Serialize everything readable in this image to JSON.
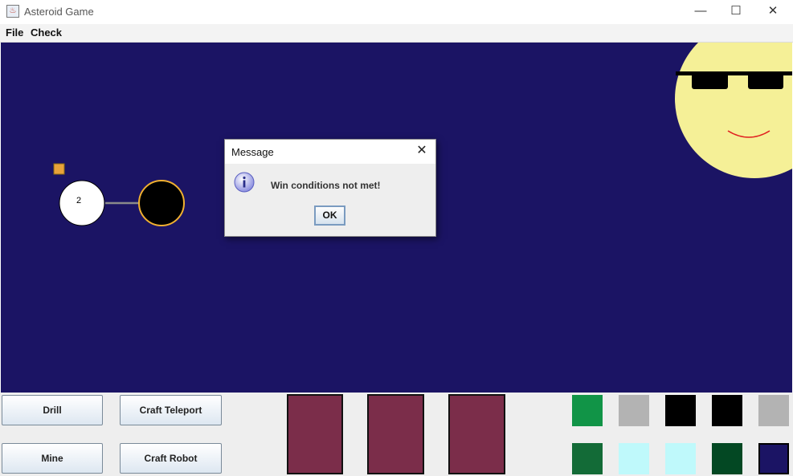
{
  "window": {
    "title": "Asteroid Game",
    "minimize_glyph": "—",
    "maximize_glyph": "☐",
    "close_glyph": "✕",
    "app_icon_glyph": "♨"
  },
  "menu": [
    {
      "label": "File"
    },
    {
      "label": "Check"
    }
  ],
  "game": {
    "background_color": "#1b1464",
    "asteroids": [
      {
        "label": "2",
        "fill": "#ffffff",
        "outline": "#000000"
      },
      {
        "label": "",
        "fill": "#000000",
        "outline": "#f0b030"
      }
    ],
    "sun": {
      "fill": "#f5f097",
      "glasses": "#000000",
      "smile": "#e02020"
    },
    "settler_color": "#e8a33a"
  },
  "dialog": {
    "title": "Message",
    "message": "Win conditions not met!",
    "ok_label": "OK",
    "icon": "info-icon",
    "close_glyph": "✕"
  },
  "buttons": {
    "drill": "Drill",
    "craft_teleport": "Craft Teleport",
    "mine": "Mine",
    "craft_robot": "Craft Robot"
  },
  "inventory_slots": [
    {
      "color": "#7b2d4a"
    },
    {
      "color": "#7b2d4a"
    },
    {
      "color": "#7b2d4a"
    }
  ],
  "resource_colors": [
    {
      "color": "#119447"
    },
    {
      "color": "#b3b3b3"
    },
    {
      "color": "#000000"
    },
    {
      "color": "#000000"
    },
    {
      "color": "#b3b3b3"
    },
    {
      "color": "#136b37"
    },
    {
      "color": "#bff9fb"
    },
    {
      "color": "#bff9fb"
    },
    {
      "color": "#034823"
    },
    {
      "color": "#1b1464"
    }
  ]
}
